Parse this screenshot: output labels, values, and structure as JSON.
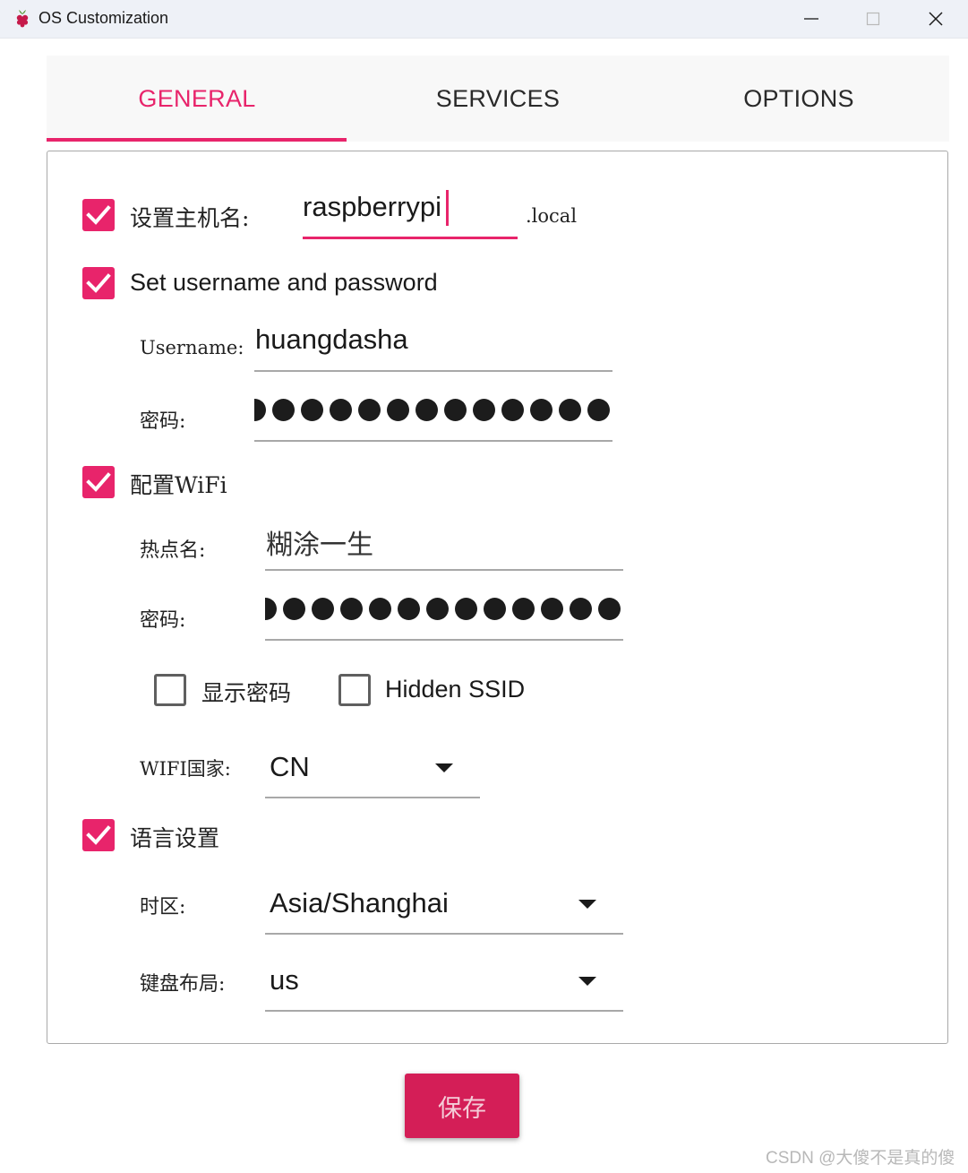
{
  "window": {
    "title": "OS Customization",
    "app_icon": "raspberry-pi-icon",
    "controls": [
      "minimize-icon",
      "maximize-icon",
      "close-icon"
    ]
  },
  "tabs": [
    {
      "label": "GENERAL",
      "active": true
    },
    {
      "label": "SERVICES",
      "active": false
    },
    {
      "label": "OPTIONS",
      "active": false
    }
  ],
  "hostname": {
    "checked": true,
    "label": "设置主机名:",
    "value": "raspberrypi",
    "suffix": ".local"
  },
  "user": {
    "checked": true,
    "label": "Set username and password",
    "username_label": "Username:",
    "username_value": "huangdasha",
    "password_label": "密码:",
    "password_mask": "●●●●●●●●●●●●●"
  },
  "wifi": {
    "checked": true,
    "label": "配置WiFi",
    "ssid_label": "热点名:",
    "ssid_value": "糊涂一生",
    "password_label": "密码:",
    "password_mask": "●●●●●●●●●●●●●",
    "show_password": {
      "label": "显示密码",
      "checked": false
    },
    "hidden_ssid": {
      "label": "Hidden SSID",
      "checked": false
    },
    "country_label": "WIFI国家:",
    "country_value": "CN"
  },
  "locale": {
    "checked": true,
    "label": "语言设置",
    "timezone_label": "时区:",
    "timezone_value": "Asia/Shanghai",
    "keyboard_label": "键盘布局:",
    "keyboard_value": "us"
  },
  "save_label": "保存",
  "watermark": "CSDN @大傻不是真的傻",
  "colors": {
    "accent": "#e8246b",
    "save_button": "#d41e57",
    "checkbox_off": "#5f5f5f"
  }
}
